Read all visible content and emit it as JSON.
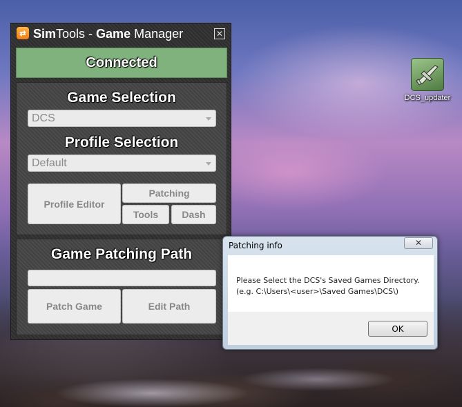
{
  "simtools": {
    "title_part1": "Sim",
    "title_part2": "Tools",
    "title_part3": " - ",
    "title_part4": "Game",
    "title_part5": " Manager",
    "logo_text": "⇄",
    "close_glyph": "✕",
    "status": "Connected",
    "status_color": "#7fb27c",
    "game_selection_heading": "Game Selection",
    "game_selected": "DCS",
    "profile_selection_heading": "Profile Selection",
    "profile_selected": "Default",
    "buttons": {
      "profile_editor": "Profile Editor",
      "patching": "Patching",
      "tools": "Tools",
      "dash": "Dash",
      "patch_game": "Patch Game",
      "edit_path": "Edit Path"
    },
    "patch_path_heading": "Game Patching Path",
    "patch_path_value": ""
  },
  "desktop_icon": {
    "label": "DCS_updater",
    "icon": "aircraft-icon"
  },
  "dialog": {
    "title": "Patching info",
    "close_glyph": "✕",
    "message_line1": "Please Select the DCS's Saved Games Directory.",
    "message_line2": "(e.g. C:\\Users\\<user>\\Saved Games\\DCS\\)",
    "ok_label": "OK"
  }
}
